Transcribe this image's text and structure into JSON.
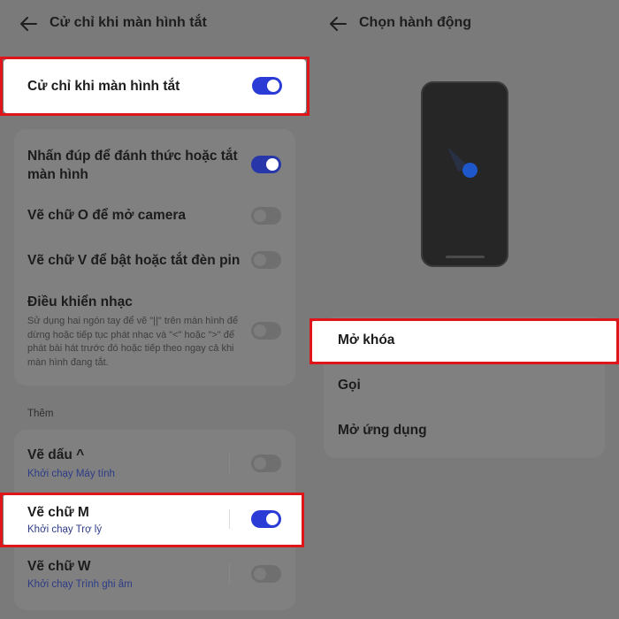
{
  "left": {
    "header": {
      "title": "Cử chỉ khi màn hình tắt"
    },
    "master": {
      "label": "Cử chỉ khi màn hình tắt",
      "enabled": true
    },
    "gestures": [
      {
        "label": "Nhấn đúp để đánh thức hoặc tắt màn hình",
        "enabled": true
      },
      {
        "label": "Vẽ chữ O để mở camera",
        "enabled": false
      },
      {
        "label": "Vẽ chữ V để bật hoặc tắt đèn pin",
        "enabled": false
      },
      {
        "label": "Điều khiển nhạc",
        "description": "Sử dụng hai ngón tay để vẽ \"||\" trên màn hình để dừng hoặc tiếp tục phát nhạc và \"<\" hoặc \">\" để phát bài hát trước đó hoặc tiếp theo ngay cả khi màn hình đang tắt.",
        "enabled": false
      }
    ],
    "more_label": "Thêm",
    "more": [
      {
        "label": "Vẽ dấu ^",
        "sub": "Khởi chạy Máy tính",
        "enabled": false
      },
      {
        "label": "Vẽ chữ M",
        "sub": "Khởi chạy Trợ lý",
        "enabled": true
      },
      {
        "label": "Vẽ chữ W",
        "sub": "Khởi chạy Trình ghi âm",
        "enabled": false
      }
    ]
  },
  "right": {
    "header": {
      "title": "Chọn hành động"
    },
    "actions": [
      {
        "label": "Mở khóa"
      },
      {
        "label": "Gọi"
      },
      {
        "label": "Mở ứng dụng"
      }
    ]
  },
  "colors": {
    "toggle_on": "#2736a8",
    "highlight": "#e0151c",
    "accent_text": "#2d3b87"
  }
}
